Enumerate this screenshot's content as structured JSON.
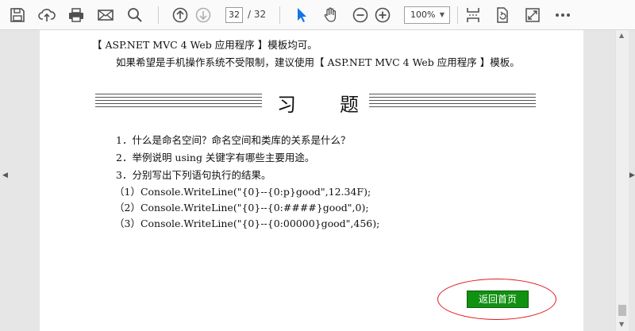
{
  "toolbar": {
    "page_current": "32",
    "page_total": "/  32",
    "zoom_value": "100%"
  },
  "document": {
    "line1": "【 ASP.NET MVC 4 Web 应用程序 】模板均可。",
    "line2": "如果希望是手机操作系统不受限制，建议使用【 ASP.NET MVC 4 Web 应用程序 】模板。",
    "heading_char1": "习",
    "heading_char2": "题",
    "questions": [
      "1．什么是命名空间？命名空间和类库的关系是什么？",
      "2．举例说明 using 关键字有哪些主要用途。",
      "3．分别写出下列语句执行的结果。",
      "（1）Console.WriteLine(\"{0}--{0:p}good\",12.34F);",
      "（2）Console.WriteLine(\"{0}--{0:####}good\",0);",
      "（3）Console.WriteLine(\"{0}--{0:00000}good\",456);"
    ],
    "home_button": "返回首页"
  },
  "colors": {
    "home_button_bg": "#119111",
    "annotation_oval": "#e21a1a",
    "pointer_tool": "#1473e6"
  }
}
